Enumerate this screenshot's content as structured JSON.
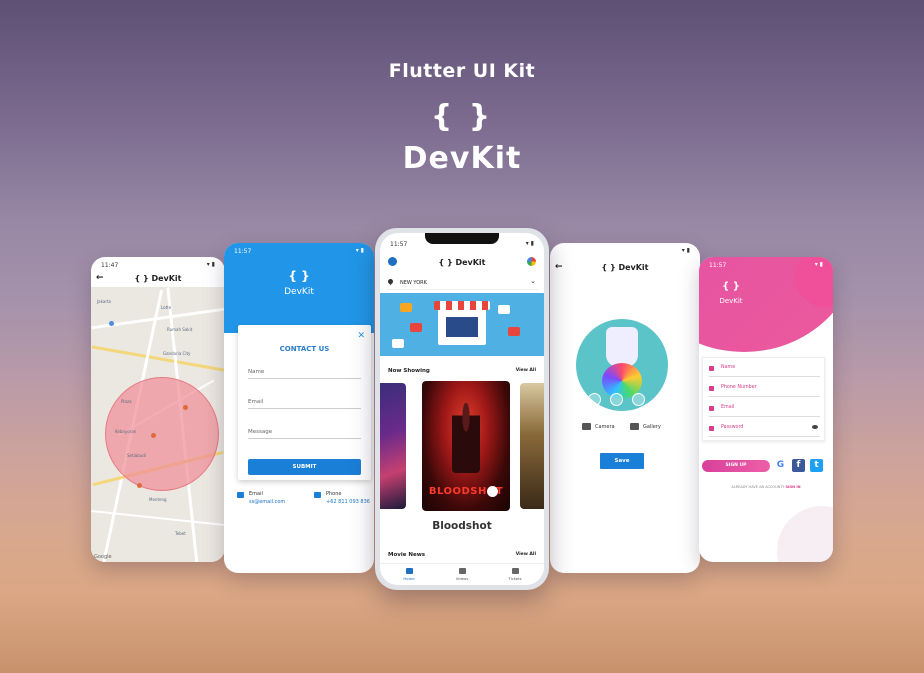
{
  "hero": {
    "subtitle": "Flutter UI Kit",
    "braces": "{ }",
    "brand": "DevKit"
  },
  "phones": {
    "map": {
      "time": "11:47",
      "title": "{ } DevKit",
      "back_icon": "arrow-left-icon",
      "labels": [
        "Jakarta",
        "Lotte",
        "Rumah Sakit",
        "Gandaria City",
        "Plaza",
        "Kebayoran",
        "Setiabudi",
        "Menteng",
        "Tebet"
      ],
      "attribution": "Google",
      "circle_color": "#f08c96"
    },
    "contact": {
      "time": "11:57",
      "braces": "{ }",
      "brand": "DevKit",
      "close_icon": "close-icon",
      "heading": "CONTACT US",
      "fields": [
        "Name",
        "Email",
        "Message"
      ],
      "submit": "SUBMIT",
      "email_label": "Email",
      "email_value": "ss@email.com",
      "phone_label": "Phone",
      "phone_value": "+62 811 093 836",
      "accent": "#2196e8"
    },
    "movies": {
      "time": "11:57",
      "title": "{ } DevKit",
      "location": "NEW YORK",
      "now_showing": "Now Showing",
      "view_all": "View All",
      "poster_title": "BLOODSHOT",
      "movie_title": "Bloodshot",
      "news": "Movie News",
      "news_view_all": "View All",
      "nav": [
        "Home",
        "Videos",
        "Tickets"
      ]
    },
    "camera": {
      "title": "{ } DevKit",
      "camera": "Camera",
      "gallery": "Gallery",
      "save": "Save"
    },
    "signup": {
      "time": "11:57",
      "braces": "{ }",
      "brand": "DevKit",
      "fields": [
        "Name",
        "Phone Number",
        "Email",
        "Password"
      ],
      "signup": "SIGN UP",
      "account_text": "ALREADY HAVE AN ACCOUNT?",
      "signin": "SIGN IN",
      "accent": "#e14fa7"
    }
  }
}
